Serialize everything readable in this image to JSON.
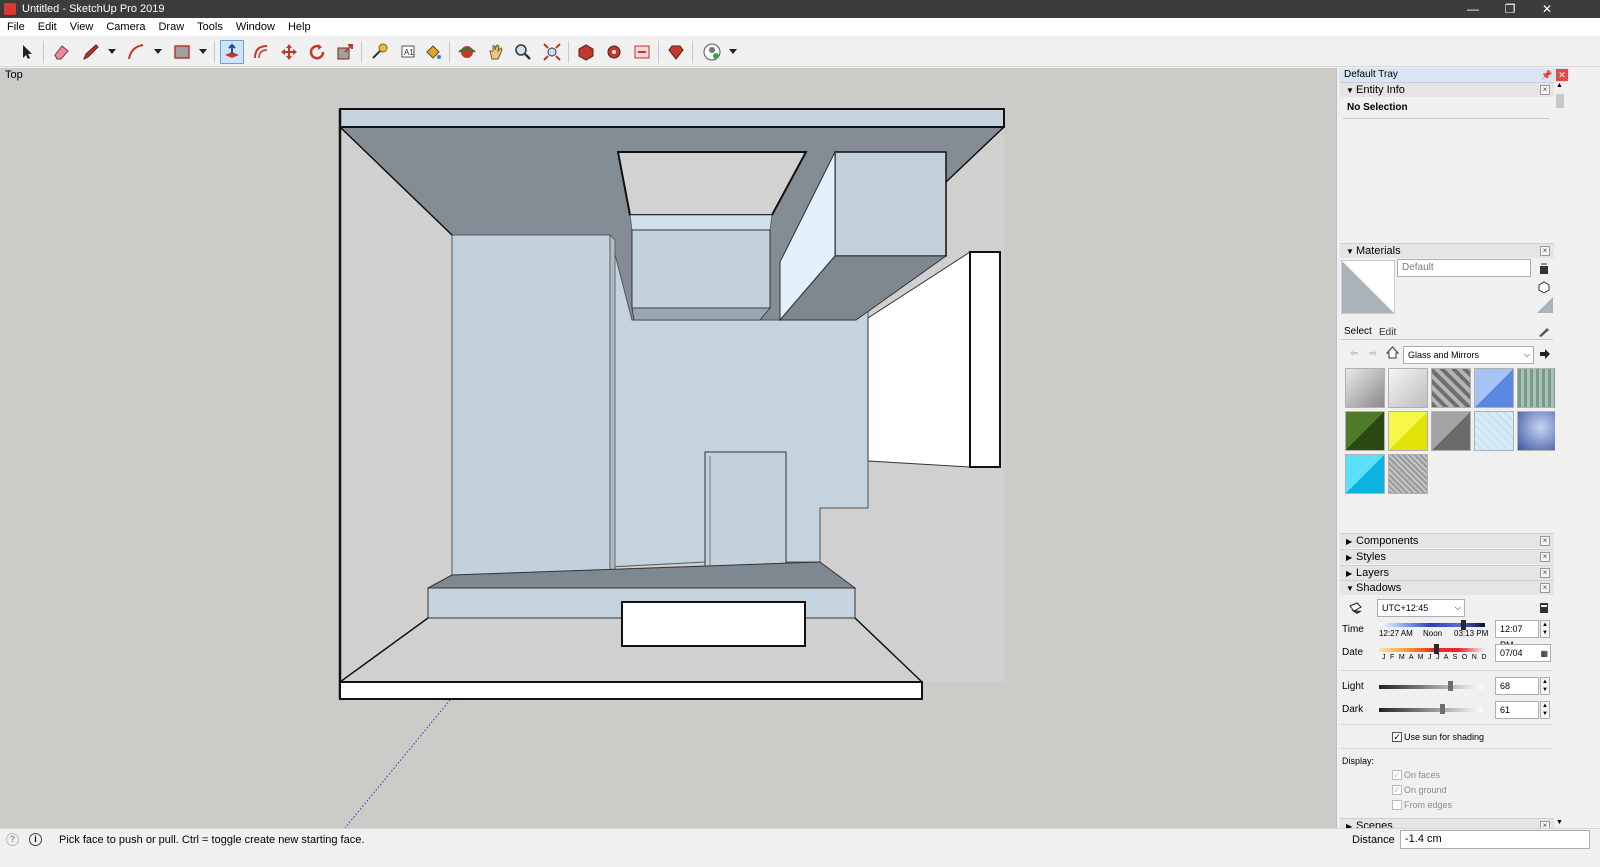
{
  "window": {
    "title": "Untitled - SketchUp Pro 2019",
    "controls": {
      "minimize": "—",
      "restore": "❐",
      "close": "✕"
    }
  },
  "menu": [
    "File",
    "Edit",
    "View",
    "Camera",
    "Draw",
    "Tools",
    "Window",
    "Help"
  ],
  "toolbar": {
    "tools": [
      {
        "icon": "select-arrow-icon"
      },
      {
        "icon": "eraser-icon"
      },
      {
        "icon": "line-pencil-icon"
      },
      {
        "icon": "arc-icon"
      },
      {
        "icon": "rectangle-icon"
      },
      {
        "icon": "push-pull-icon",
        "active": true
      },
      {
        "icon": "offset-icon"
      },
      {
        "icon": "move-icon"
      },
      {
        "icon": "rotate-icon"
      },
      {
        "icon": "scale-icon"
      },
      {
        "icon": "tape-measure-icon"
      },
      {
        "icon": "text-icon"
      },
      {
        "icon": "paint-bucket-icon"
      },
      {
        "icon": "orbit-icon"
      },
      {
        "icon": "pan-icon"
      },
      {
        "icon": "zoom-icon"
      },
      {
        "icon": "zoom-extents-icon"
      },
      {
        "icon": "3d-warehouse-icon"
      },
      {
        "icon": "extension-warehouse-icon"
      },
      {
        "icon": "layout-send-icon"
      },
      {
        "icon": "extension-manager-icon"
      },
      {
        "icon": "account-icon"
      }
    ]
  },
  "viewport": {
    "scene_label": "Top"
  },
  "tray": {
    "title": "Default Tray",
    "entity_info": {
      "label": "Entity Info",
      "selection": "No Selection"
    },
    "materials": {
      "label": "Materials",
      "current_material": "Default",
      "tabs": [
        "Select",
        "Edit"
      ],
      "library": "Glass and Mirrors",
      "swatch_colors": [
        "#a9a9a9",
        "#d4d4d4",
        "#8a8a8a",
        "#7da0e8",
        "#8fae9f",
        "#365a1c",
        "#f2f219",
        "#868686",
        "#cfe6f5",
        "#5d77b8",
        "#1ec9ef",
        "#a6a6a6"
      ]
    },
    "collapsed_panels": [
      "Components",
      "Styles",
      "Layers"
    ],
    "shadows": {
      "label": "Shadows",
      "timezone": "UTC+12:45",
      "time_label": "Time",
      "time_ticks": [
        "12:27 AM",
        "Noon",
        "03:13 PM"
      ],
      "time_value": "12:07 PM",
      "date_label": "Date",
      "date_months": "J F M A M J J A S O N D",
      "date_value": "07/04",
      "light_label": "Light",
      "light_value": "68",
      "light_level": 0.68,
      "dark_label": "Dark",
      "dark_value": "61",
      "dark_level": 0.61,
      "use_sun_label": "Use sun for shading",
      "use_sun_checked": true,
      "display_label": "Display:",
      "display_options": [
        {
          "label": "On faces",
          "checked": true
        },
        {
          "label": "On ground",
          "checked": true
        },
        {
          "label": "From edges",
          "checked": false
        }
      ]
    },
    "scenes_label": "Scenes"
  },
  "statusbar": {
    "hint": "Pick face to push or pull.  Ctrl = toggle create new starting face.",
    "vcb_label": "Distance",
    "vcb_value": "-1.4 cm"
  }
}
